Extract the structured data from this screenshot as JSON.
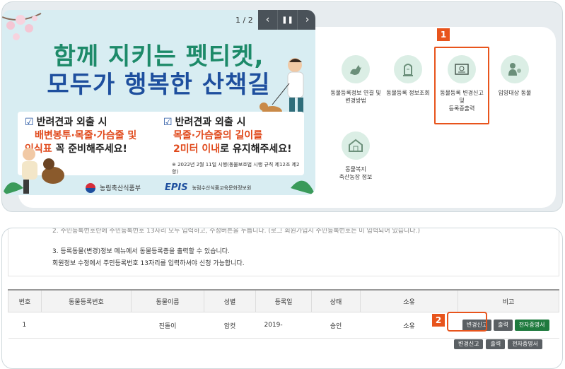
{
  "banner": {
    "counter": "1 / 2",
    "headline_line1": "함께 지키는 펫티켓,",
    "headline_line2": "모두가 행복한 산책길",
    "left_title": "반려견과 외출 시",
    "left_hl1": "배변봉투·목줄·가슴줄 및",
    "left_hl2": "인식표",
    "left_tail": "꼭 준비해주세요!",
    "right_title": "반려견과 외출 시",
    "right_hl1": "목줄·가슴줄의 길이를",
    "right_hl2": "2미터 이내",
    "right_tail": "로 유지해주세요!",
    "note": "※ 2022년 2월 11일 시행(동물보호법 시행 규칙 제12조 제2항)",
    "logo1": "농림축산식품부",
    "logo2_mark": "EPIS",
    "logo2": "농림수산식품교육문화정보원"
  },
  "menu": {
    "item1": "동물등록정보 연결 및 변경방법",
    "item2": "동물등록 정보조회",
    "item3_line1": "동물등록 변경신고",
    "item3_line2": "및",
    "item3_line3": "등록증출력",
    "item4": "입양대상 동물",
    "item5_line1": "동물복지",
    "item5_line2": "축산농장 정보"
  },
  "badges": {
    "one": "1",
    "two": "2"
  },
  "notice": {
    "line2_partial": "2. 주민등록번호란에 주민등록번호 13자리 모두 입력하고, 수정버튼을 누릅니다. (로그 회원가입시 주민등록번호는 미 입력되어 있습니다.)",
    "line3": "3. 등록동물(변경)정보 메뉴에서 동물등록증을 출력할 수 있습니다.",
    "line4": "회원정보 수정에서 주민등록번호 13자리를 입력하셔야 신청 가능합니다."
  },
  "table": {
    "headers": [
      "번호",
      "동물등록번호",
      "동물이름",
      "성별",
      "등록일",
      "상태",
      "소유",
      "비고"
    ],
    "row": {
      "no": "1",
      "reg_no": "",
      "name": "진돌이",
      "sex": "암컷",
      "date": "2019-",
      "status": "승인",
      "owner": "소유"
    },
    "buttons": {
      "change": "변경신고",
      "print": "출력",
      "certificate": "전자증명서"
    },
    "ghost_buttons": {
      "change": "변경신고",
      "print": "출력",
      "certificate": "전자증명서"
    }
  },
  "colors": {
    "accent_orange": "#e8541c",
    "green": "#1d8a69",
    "blue": "#1e4f9e",
    "btn_green": "#1f7a3e"
  }
}
